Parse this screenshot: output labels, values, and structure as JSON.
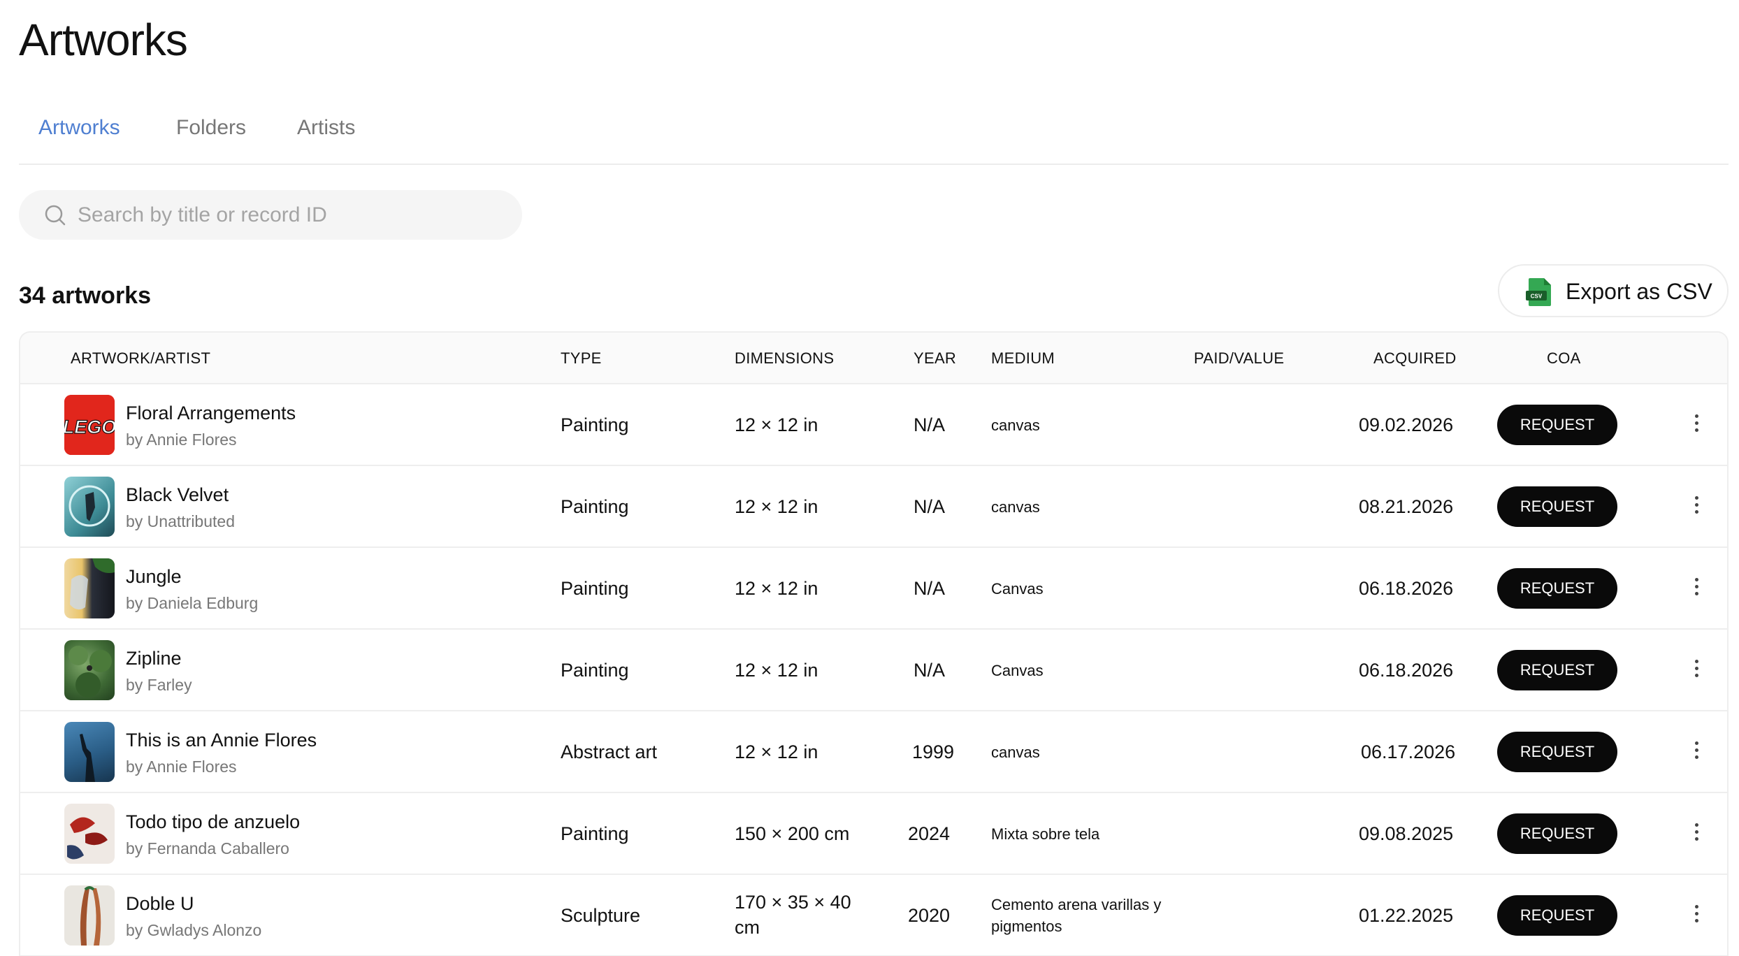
{
  "header": {
    "title": "Artworks"
  },
  "tabs": [
    {
      "label": "Artworks",
      "active": true
    },
    {
      "label": "Folders",
      "active": false
    },
    {
      "label": "Artists",
      "active": false
    }
  ],
  "search": {
    "placeholder": "Search by title or record ID",
    "icon": "search-icon"
  },
  "summary": {
    "count_label": "34 artworks"
  },
  "export": {
    "label": "Export as CSV",
    "icon": "csv-file-icon",
    "icon_text": "CSV"
  },
  "table": {
    "columns": [
      "ARTWORK/ARTIST",
      "TYPE",
      "DIMENSIONS",
      "YEAR",
      "MEDIUM",
      "PAID/VALUE",
      "ACQUIRED",
      "COA"
    ],
    "rows": [
      {
        "title": "Floral Arrangements",
        "artist": "by Annie Flores",
        "type": "Painting",
        "dimensions": "12 × 12 in",
        "year": "N/A",
        "medium": "canvas",
        "paid_value": "",
        "acquired": "09.02.2026",
        "coa": "REQUEST",
        "thumb_text": "LEGO"
      },
      {
        "title": "Black Velvet",
        "artist": "by Unattributed",
        "type": "Painting",
        "dimensions": "12 × 12 in",
        "year": "N/A",
        "medium": "canvas",
        "paid_value": "",
        "acquired": "08.21.2026",
        "coa": "REQUEST"
      },
      {
        "title": "Jungle",
        "artist": "by Daniela Edburg",
        "type": "Painting",
        "dimensions": "12 × 12 in",
        "year": "N/A",
        "medium": "Canvas",
        "paid_value": "",
        "acquired": "06.18.2026",
        "coa": "REQUEST"
      },
      {
        "title": "Zipline",
        "artist": "by Farley",
        "type": "Painting",
        "dimensions": "12 × 12 in",
        "year": "N/A",
        "medium": "Canvas",
        "paid_value": "",
        "acquired": "06.18.2026",
        "coa": "REQUEST"
      },
      {
        "title": "This is an Annie Flores",
        "artist": "by Annie Flores",
        "type": "Abstract art",
        "dimensions": "12 × 12 in",
        "year": "1999",
        "medium": "canvas",
        "paid_value": "",
        "acquired": "06.17.2026",
        "coa": "REQUEST"
      },
      {
        "title": "Todo tipo de anzuelo",
        "artist": "by Fernanda Caballero",
        "type": "Painting",
        "dimensions": "150 × 200 cm",
        "year": "2024",
        "medium": "Mixta sobre tela",
        "paid_value": "",
        "acquired": "09.08.2025",
        "coa": "REQUEST"
      },
      {
        "title": "Doble U",
        "artist": "by Gwladys Alonzo",
        "type": "Sculpture",
        "dimensions_line1": "170 × 35 × 40",
        "dimensions_line2": "cm",
        "year": "2020",
        "medium_line1": "Cemento arena varillas y",
        "medium_line2": "pigmentos",
        "paid_value": "",
        "acquired": "01.22.2025",
        "coa": "REQUEST"
      }
    ]
  },
  "colors": {
    "accent": "#4f7fd1",
    "button_bg": "#0a0a0a",
    "muted_text": "#777777"
  }
}
